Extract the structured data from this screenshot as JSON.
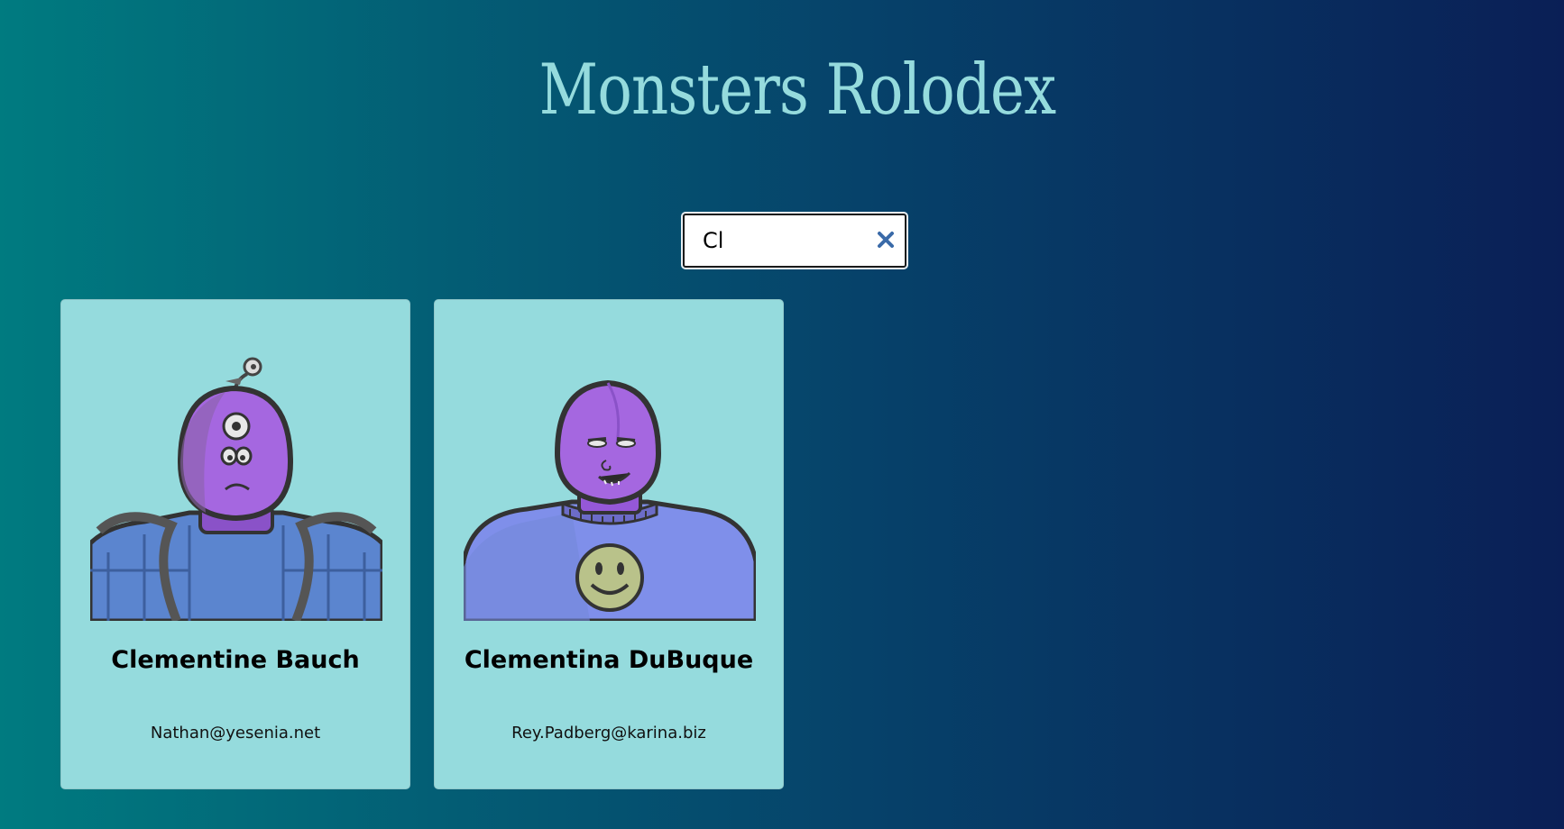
{
  "app": {
    "title": "Monsters Rolodex"
  },
  "search": {
    "value": "Cl",
    "clear_icon": "close-icon"
  },
  "monsters": [
    {
      "name": "Clementine Bauch",
      "email": "Nathan@yesenia.net",
      "avatar_icon": "robot-monster-avatar"
    },
    {
      "name": "Clementina DuBuque",
      "email": "Rey.Padberg@karina.biz",
      "avatar_icon": "smiley-shirt-monster-avatar"
    }
  ],
  "colors": {
    "title": "#95dbdd",
    "card_background": "#95dbdd",
    "gradient_start": "#007b80",
    "gradient_end": "#0a1f56",
    "clear_icon": "#3a6aa8",
    "monster_skin": "#a567e0"
  }
}
